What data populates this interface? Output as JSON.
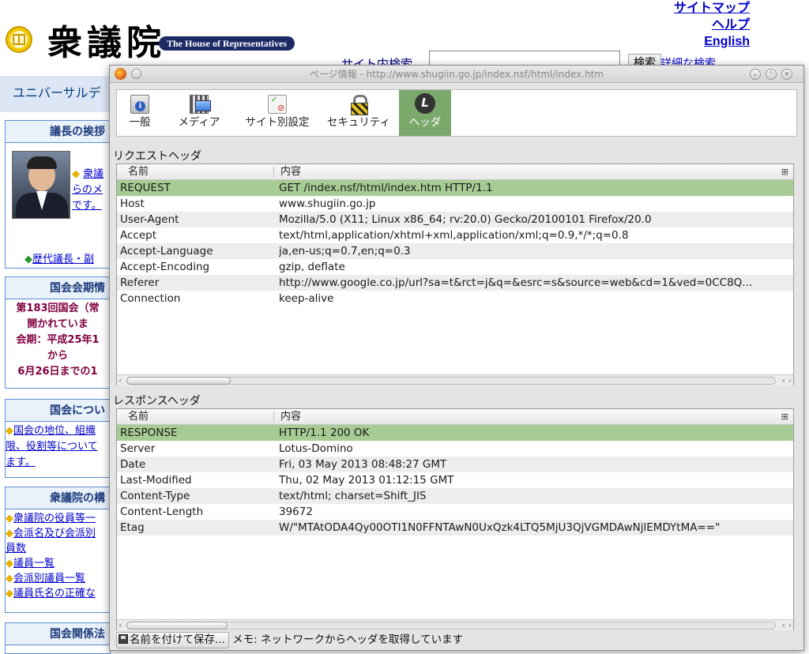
{
  "background_page": {
    "logo_text": "衆議院",
    "house_label": "The House of Representatives",
    "top_links": [
      "サイトマップ",
      "ヘルプ",
      "English"
    ],
    "site_search_label": "サイト内検索",
    "search_button": "検索",
    "advanced_search": "詳細な検索",
    "universal_label": "ユニバーサルデ",
    "speaker_box": {
      "title": "議長の挨拶",
      "link_lines": [
        "衆議",
        "らのメ",
        "です。"
      ],
      "past_link": "歴代議長・副"
    },
    "session_box": {
      "title": "国会会期情",
      "lines": [
        "第183回国会（常",
        "開かれていま",
        "会期：平成25年1",
        "から",
        "6月26日までの1"
      ]
    },
    "about_box": {
      "title": "国会につい",
      "lines": [
        "国会の地位、組織",
        "限、役割等について",
        "ます。"
      ]
    },
    "composition_box": {
      "title": "衆議院の構",
      "items": [
        "衆議院の役員等一",
        "会派名及び会派別",
        "員数",
        "議員一覧",
        "会派別議員一覧",
        "議員氏名の正確な"
      ]
    },
    "related_box": {
      "title": "国会関係法"
    }
  },
  "dialog": {
    "title": "ページ情報 - http://www.shugiin.go.jp/index.nsf/html/index.htm",
    "tabs": [
      {
        "label": "一般",
        "icon": "info-icon"
      },
      {
        "label": "メディア",
        "icon": "media-icon"
      },
      {
        "label": "サイト別設定",
        "icon": "permissions-icon"
      },
      {
        "label": "セキュリティ",
        "icon": "lock-icon"
      },
      {
        "label": "ヘッダ",
        "icon": "live-http-headers-icon"
      }
    ],
    "active_tab": "ヘッダ",
    "request_section": {
      "title": "リクエストヘッダ",
      "columns": [
        "名前",
        "内容"
      ],
      "rows": [
        {
          "name": "REQUEST",
          "value": "GET /index.nsf/html/index.htm HTTP/1.1"
        },
        {
          "name": "Host",
          "value": "www.shugiin.go.jp"
        },
        {
          "name": "User-Agent",
          "value": "Mozilla/5.0 (X11; Linux x86_64; rv:20.0) Gecko/20100101 Firefox/20.0"
        },
        {
          "name": "Accept",
          "value": "text/html,application/xhtml+xml,application/xml;q=0.9,*/*;q=0.8"
        },
        {
          "name": "Accept-Language",
          "value": "ja,en-us;q=0.7,en;q=0.3"
        },
        {
          "name": "Accept-Encoding",
          "value": "gzip, deflate"
        },
        {
          "name": "Referer",
          "value": "http://www.google.co.jp/url?sa=t&rct=j&q=&esrc=s&source=web&cd=1&ved=0CC8Q..."
        },
        {
          "name": "Connection",
          "value": "keep-alive"
        }
      ]
    },
    "response_section": {
      "title": "レスポンスヘッダ",
      "columns": [
        "名前",
        "内容"
      ],
      "rows": [
        {
          "name": "RESPONSE",
          "value": "HTTP/1.1 200 OK"
        },
        {
          "name": "Server",
          "value": "Lotus-Domino"
        },
        {
          "name": "Date",
          "value": "Fri, 03 May 2013 08:48:27 GMT"
        },
        {
          "name": "Last-Modified",
          "value": "Thu, 02 May 2013 01:12:15 GMT"
        },
        {
          "name": "Content-Type",
          "value": "text/html; charset=Shift_JIS"
        },
        {
          "name": "Content-Length",
          "value": "39672"
        },
        {
          "name": "Etag",
          "value": "W/\"MTAtODA4Qy00OTI1N0FFNTAwN0UxQzk4LTQ5MjU3QjVGMDAwNjlEMDYtMA==\""
        }
      ]
    },
    "save_button": "名前を付けて保存...",
    "status_text": "メモ: ネットワークからヘッダを取得しています",
    "colors": {
      "selected_row": "#a6cc94",
      "active_tab": "#7ba86b"
    }
  }
}
